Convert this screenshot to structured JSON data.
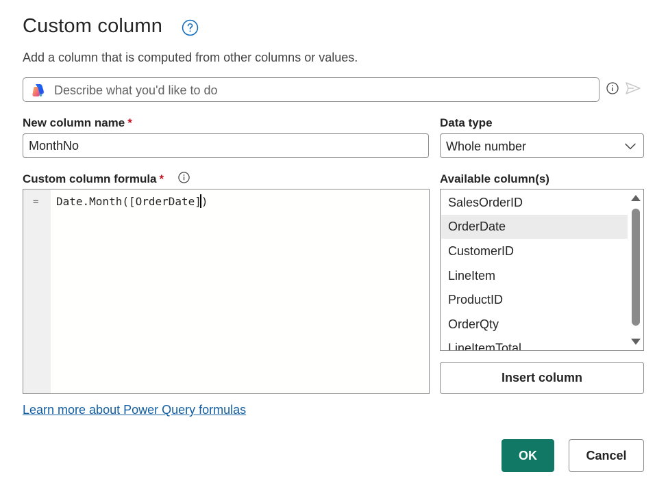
{
  "dialog": {
    "title": "Custom column",
    "subtitle": "Add a column that is computed from other columns or values."
  },
  "copilot": {
    "placeholder": "Describe what you'd like to do"
  },
  "new_column": {
    "label": "New column name",
    "required_mark": "*",
    "value": "MonthNo"
  },
  "data_type": {
    "label": "Data type",
    "selected": "Whole number"
  },
  "formula": {
    "label": "Custom column formula",
    "required_mark": "*",
    "prefix": "=",
    "text": "Date.Month([OrderDate]",
    "text_after_caret": ")"
  },
  "available_columns": {
    "label": "Available column(s)",
    "items": [
      {
        "label": "SalesOrderID"
      },
      {
        "label": "OrderDate"
      },
      {
        "label": "CustomerID"
      },
      {
        "label": "LineItem"
      },
      {
        "label": "ProductID"
      },
      {
        "label": "OrderQty"
      },
      {
        "label": "LineItemTotal"
      }
    ],
    "selected_index": 1
  },
  "buttons": {
    "insert_column": "Insert column",
    "ok": "OK",
    "cancel": "Cancel"
  },
  "learn_more_link": "Learn more about Power Query formulas",
  "colors": {
    "accent": "#117865",
    "link": "#115ea3",
    "required": "#c50f1f",
    "help_icon": "#0f6cbd"
  },
  "icons": {
    "help": "question-circle-icon",
    "copilot": "copilot-logo-icon",
    "info": "info-icon",
    "send": "send-icon",
    "dropdown": "chevron-down-icon"
  }
}
